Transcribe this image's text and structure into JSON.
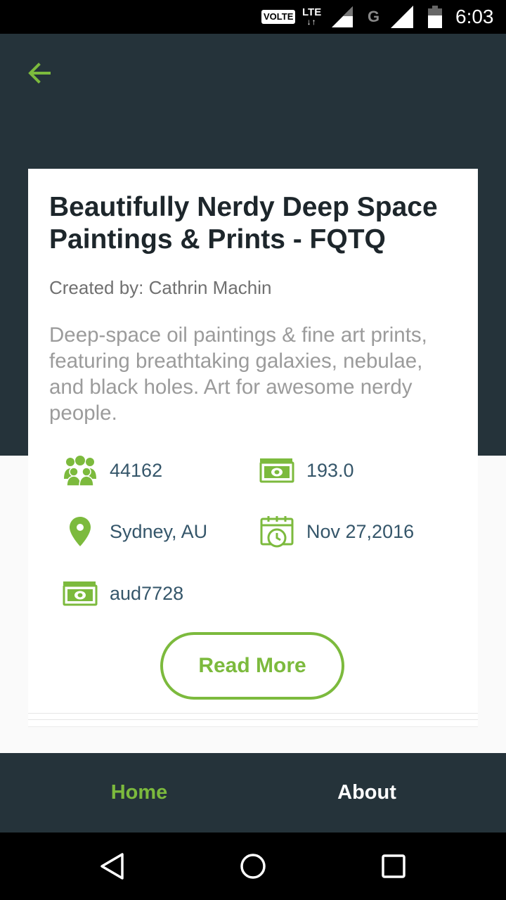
{
  "status_bar": {
    "volte": "VOLTE",
    "network": "LTE",
    "network2": "G",
    "time": "6:03"
  },
  "project": {
    "title": "Beautifully Nerdy Deep Space Paintings & Prints - FQTQ",
    "creator": "Created by: Cathrin Machin",
    "description": "Deep-space oil paintings & fine art prints, featuring breathtaking galaxies, nebulae, and black holes. Art for awesome nerdy people.",
    "backers": "44162",
    "pledged": "193.0",
    "location": "Sydney, AU",
    "date": "Nov 27,2016",
    "currency": "aud7728",
    "read_more_label": "Read More"
  },
  "nav": {
    "home_label": "Home",
    "about_label": "About",
    "active": "Home"
  },
  "colors": {
    "accent": "#7cba3d",
    "header_bg": "#25333a",
    "stat_text": "#35566a"
  },
  "icons": {
    "back": "arrow-left-icon",
    "backers": "people-group-icon",
    "pledged": "money-icon",
    "location": "map-pin-icon",
    "date": "calendar-clock-icon",
    "currency": "money-icon"
  }
}
